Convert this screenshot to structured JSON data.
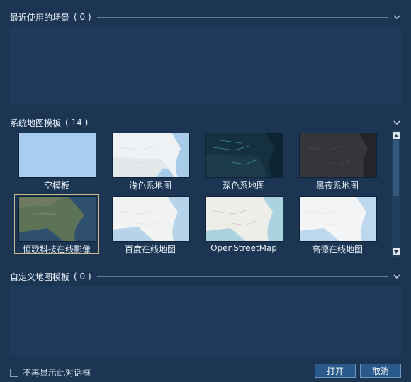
{
  "recent": {
    "title": "最近使用的场景",
    "count": "( 0 )"
  },
  "system": {
    "title": "系统地图模板",
    "count": "( 14 )",
    "templates": [
      {
        "label": "空模板"
      },
      {
        "label": "浅色系地图"
      },
      {
        "label": "深色系地图"
      },
      {
        "label": "黑夜系地图"
      },
      {
        "label": "恒歌科技在线影像"
      },
      {
        "label": "百度在线地图"
      },
      {
        "label": "OpenStreetMap"
      },
      {
        "label": "高德在线地图"
      }
    ]
  },
  "custom": {
    "title": "自定义地图模板",
    "count": "( 0 )"
  },
  "footer": {
    "checkbox_label": "不再显示此对话框",
    "open_label": "打开",
    "cancel_label": "取消"
  },
  "colors": {
    "background": "#1b3553",
    "panel": "#1e3b5c",
    "button": "#2a5a8c",
    "selected_outline": "#c9b98a"
  },
  "icons": {
    "collapse": "chevron-down-icon",
    "scroll_up": "scroll-up-icon",
    "scroll_down": "scroll-down-icon"
  }
}
